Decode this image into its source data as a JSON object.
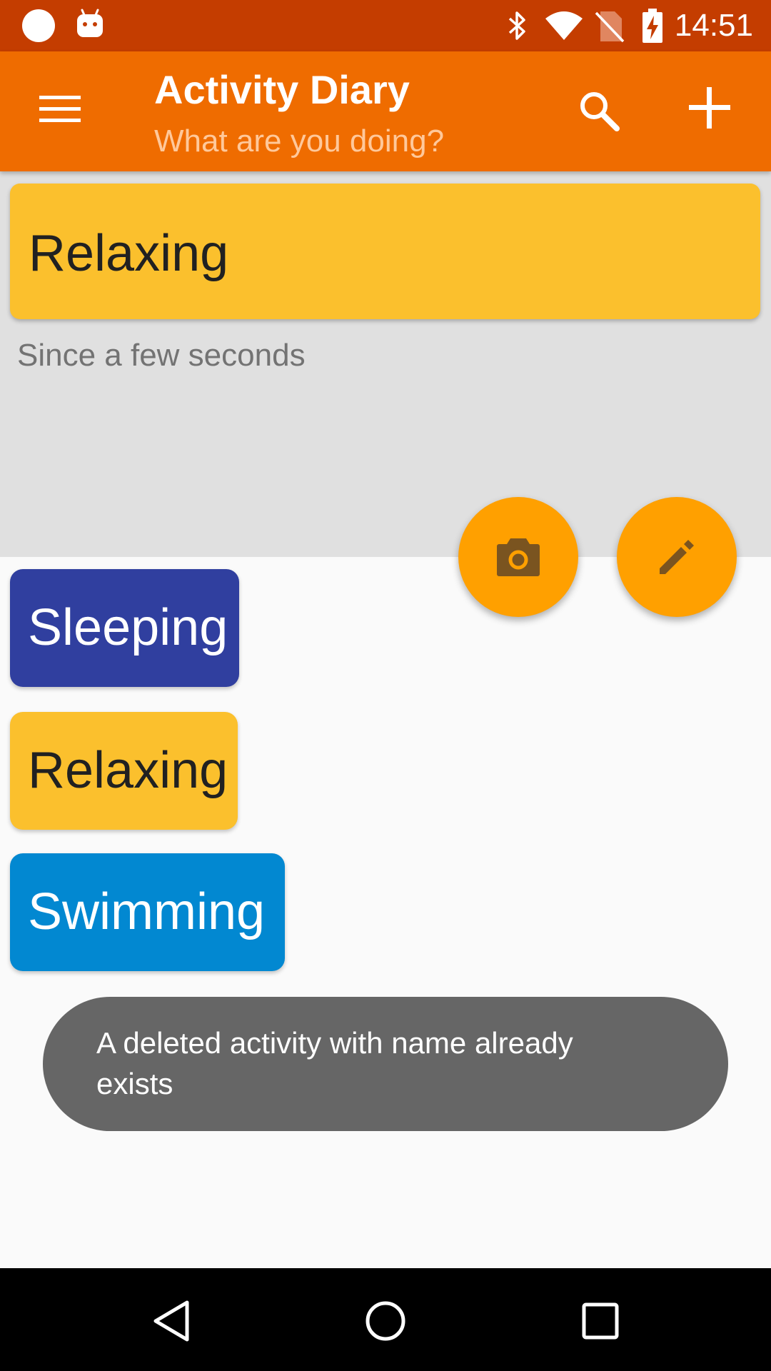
{
  "status_bar": {
    "time": "14:51",
    "left_icons": [
      "notification-circle-icon",
      "android-icon"
    ],
    "right_icons": [
      "bluetooth-icon",
      "wifi-icon",
      "no-sim-icon",
      "battery-charging-icon"
    ]
  },
  "app_bar": {
    "title": "Activity Diary",
    "subtitle": "What are you doing?",
    "icons": [
      "menu-icon",
      "search-icon",
      "add-icon"
    ]
  },
  "current_activity": {
    "name": "Relaxing",
    "duration": "Since a few seconds",
    "color": "#fbc02d"
  },
  "fabs": [
    "camera-icon",
    "edit-icon"
  ],
  "activities": [
    {
      "name": "Sleeping",
      "color": "#303f9f"
    },
    {
      "name": "Relaxing",
      "color": "#fbc02d"
    },
    {
      "name": "Swimming",
      "color": "#0288d1"
    }
  ],
  "toast": {
    "message": "A deleted activity with name  already exists"
  },
  "nav_bar": {
    "icons": [
      "back-icon",
      "home-icon",
      "recents-icon"
    ]
  },
  "colors": {
    "primary": "#ef6c00",
    "primary_dark": "#c43d00",
    "accent": "#ffa000"
  }
}
